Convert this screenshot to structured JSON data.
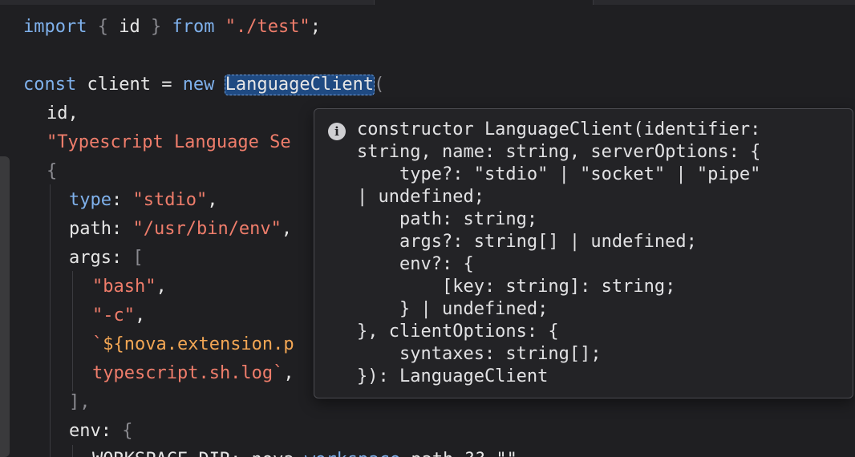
{
  "editor": {
    "lines": {
      "l1": {
        "t1": "import",
        "t2": " { ",
        "t3": "id",
        "t4": " } ",
        "t5": "from",
        "t6": " ",
        "t7": "\"./test\"",
        "t8": ";"
      },
      "l3": {
        "t1": "const",
        "t2": " client = ",
        "t3": "new",
        "t4": " ",
        "t5": "LanguageClient",
        "t6": "("
      },
      "l4": {
        "t1": "id,"
      },
      "l5": {
        "t1": "\"Typescript Language Se"
      },
      "l6": {
        "t1": "{"
      },
      "l7": {
        "t1": "type",
        "t2": ": ",
        "t3": "\"stdio\"",
        "t4": ","
      },
      "l8": {
        "t1": "path",
        "t2": ": ",
        "t3": "\"/usr/bin/env\"",
        "t4": ","
      },
      "l9": {
        "t1": "args",
        "t2": ": ",
        "t3": "["
      },
      "l10": {
        "t1": "\"bash\"",
        "t2": ","
      },
      "l11": {
        "t1": "\"-c\"",
        "t2": ","
      },
      "l12": {
        "t1": "`",
        "t2": "${nova.extension.p"
      },
      "l13": {
        "t1": "typescript.sh.log`",
        "t2": ","
      },
      "l14": {
        "t1": "],"
      },
      "l15": {
        "t1": "env",
        "t2": ": ",
        "t3": "{"
      },
      "l16": {
        "t1": "WORKSPACE_DIR: nova.",
        "t2": "workspace",
        "t3": ".path ?? \"\","
      }
    }
  },
  "tooltip": {
    "icon": "info-icon",
    "lines": [
      "constructor LanguageClient(identifier:",
      "string, name: string, serverOptions: {",
      "    type?: \"stdio\" | \"socket\" | \"pipe\"",
      "| undefined;",
      "    path: string;",
      "    args?: string[] | undefined;",
      "    env?: {",
      "        [key: string]: string;",
      "    } | undefined;",
      "}, clientOptions: {",
      "    syntaxes: string[];",
      "}): LanguageClient"
    ]
  }
}
